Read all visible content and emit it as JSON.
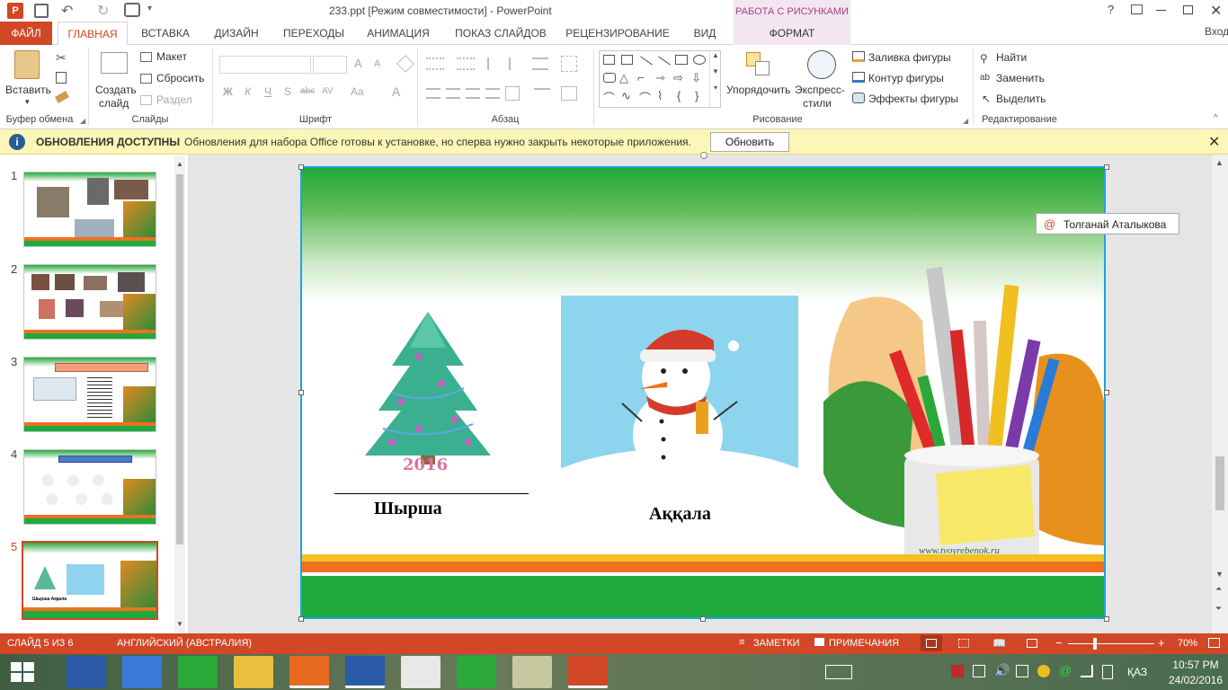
{
  "window": {
    "title": "233.ppt [Режим совместимости] - PowerPoint",
    "context_group": "РАБОТА С РИСУНКАМИ",
    "help": "?",
    "signin": "Вход"
  },
  "tabs": [
    "ФАЙЛ",
    "ГЛАВНАЯ",
    "ВСТАВКА",
    "ДИЗАЙН",
    "ПЕРЕХОДЫ",
    "АНИМАЦИЯ",
    "ПОКАЗ СЛАЙДОВ",
    "РЕЦЕНЗИРОВАНИЕ",
    "ВИД",
    "ФОРМАТ"
  ],
  "ribbon": {
    "clipboard": {
      "paste": "Вставить",
      "label": "Буфер обмена"
    },
    "slides": {
      "new_slide_1": "Создать",
      "new_slide_2": "слайд",
      "layout": "Макет",
      "reset": "Сбросить",
      "section": "Раздел",
      "label": "Слайды"
    },
    "font": {
      "bold": "Ж",
      "italic": "К",
      "underline": "Ч",
      "shadow": "S",
      "strike": "abc",
      "spacing": "AV",
      "case": "Aa",
      "color": "A",
      "grow": "A",
      "shrink": "A",
      "label": "Шрифт"
    },
    "paragraph": {
      "label": "Абзац"
    },
    "drawing": {
      "arrange": "Упорядочить",
      "styles_1": "Экспресс-",
      "styles_2": "стили",
      "fill": "Заливка фигуры",
      "outline": "Контур фигуры",
      "effects": "Эффекты фигуры",
      "label": "Рисование"
    },
    "editing": {
      "find": "Найти",
      "replace": "Заменить",
      "select": "Выделить",
      "label": "Редактирование"
    }
  },
  "infobar": {
    "title": "ОБНОВЛЕНИЯ ДОСТУПНЫ",
    "message": "Обновления для набора Office готовы к установке, но сперва нужно закрыть некоторые приложения.",
    "button": "Обновить"
  },
  "thumbnails": [
    {
      "num": "1",
      "caption": ""
    },
    {
      "num": "2",
      "caption": ""
    },
    {
      "num": "3",
      "caption": ""
    },
    {
      "num": "4",
      "caption": ""
    },
    {
      "num": "5",
      "caption": "Шырша  Аққала"
    }
  ],
  "slide": {
    "tree_label": "Шырша",
    "tree_year": "2016",
    "snowman_label": "Аққала",
    "watermark": "www.tvoyrebenok.ru",
    "comment_author": "Толганай Аталыкова"
  },
  "status": {
    "slide": "СЛАЙД 5 ИЗ 6",
    "language": "АНГЛИЙСКИЙ (АВСТРАЛИЯ)",
    "notes": "ЗАМЕТКИ",
    "comments": "ПРИМЕЧАНИЯ",
    "zoom": "70%"
  },
  "taskbar": {
    "lang": "ҚАЗ",
    "time": "10:57 PM",
    "date": "24/02/2016"
  },
  "colors": {
    "accent": "#d24726",
    "context": "#a0428c",
    "slide_green": "#1eaa3c",
    "selection": "#1aa3e0"
  }
}
